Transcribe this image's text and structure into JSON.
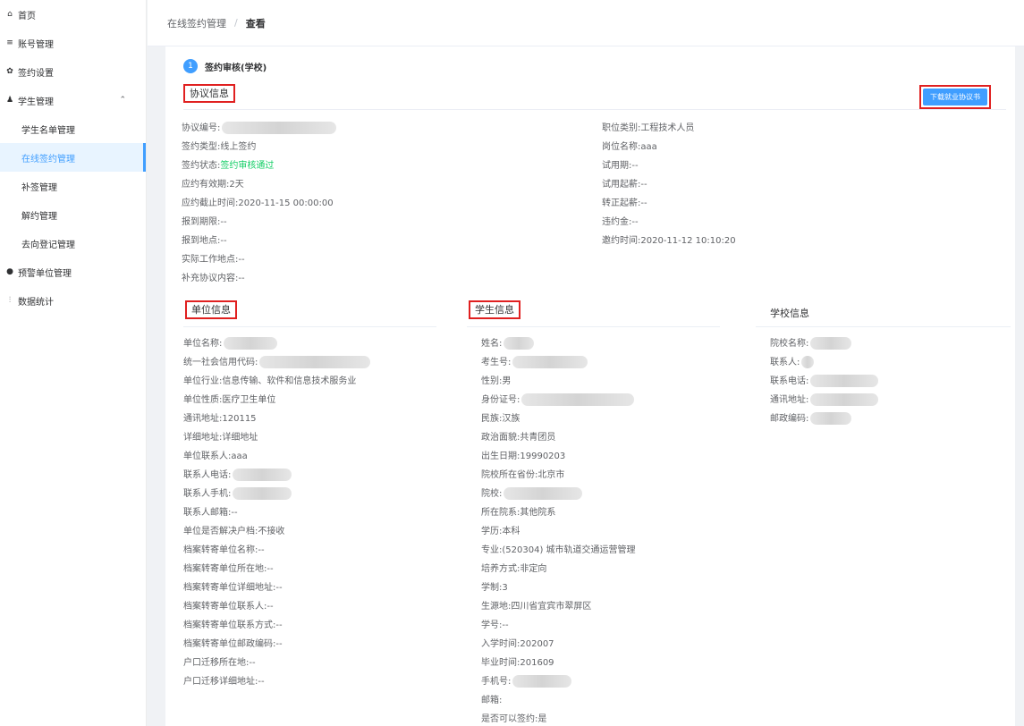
{
  "sidebar": {
    "items": [
      {
        "label": "首页",
        "icon": "home-icon"
      },
      {
        "label": "账号管理",
        "icon": "list-icon"
      },
      {
        "label": "签约设置",
        "icon": "gear-icon"
      },
      {
        "label": "学生管理",
        "icon": "students-icon"
      },
      {
        "label": "学生名单管理"
      },
      {
        "label": "在线签约管理"
      },
      {
        "label": "补签管理"
      },
      {
        "label": "解约管理"
      },
      {
        "label": "去向登记管理"
      },
      {
        "label": "预警单位管理",
        "icon": "alert-icon"
      },
      {
        "label": "数据统计",
        "icon": "chart-icon"
      }
    ]
  },
  "breadcrumb": {
    "parent": "在线签约管理",
    "separator": "/",
    "current": "查看"
  },
  "step": {
    "number": "1",
    "label": "签约审核(学校)"
  },
  "download_button": "下载就业协议书",
  "sections": {
    "agreement": "协议信息",
    "unit": "单位信息",
    "student": "学生信息",
    "school": "学校信息"
  },
  "agreement_left": [
    {
      "k": "协议编号:",
      "v": ""
    },
    {
      "k": "签约类型:",
      "v": "线上签约"
    },
    {
      "k": "签约状态:",
      "v": "签约审核通过"
    },
    {
      "k": "应约有效期:",
      "v": "2天"
    },
    {
      "k": "应约截止时间:",
      "v": "2020-11-15 00:00:00"
    },
    {
      "k": "报到期限:",
      "v": "--"
    },
    {
      "k": "报到地点:",
      "v": "--"
    },
    {
      "k": "实际工作地点:",
      "v": "--"
    },
    {
      "k": "补充协议内容:",
      "v": "--"
    }
  ],
  "agreement_right": [
    {
      "k": "职位类别:",
      "v": "工程技术人员"
    },
    {
      "k": "岗位名称:",
      "v": "aaa"
    },
    {
      "k": "试用期:",
      "v": "--"
    },
    {
      "k": "试用起薪:",
      "v": "--"
    },
    {
      "k": "转正起薪:",
      "v": "--"
    },
    {
      "k": "违约金:",
      "v": "--"
    },
    {
      "k": "邀约时间:",
      "v": "2020-11-12 10:10:20"
    }
  ],
  "unit_fields": [
    {
      "k": "单位名称:",
      "v": ""
    },
    {
      "k": "统一社会信用代码:",
      "v": ""
    },
    {
      "k": "单位行业:",
      "v": "信息传输、软件和信息技术服务业"
    },
    {
      "k": "单位性质:",
      "v": "医疗卫生单位"
    },
    {
      "k": "通讯地址:",
      "v": "120115"
    },
    {
      "k": "详细地址:",
      "v": "详细地址"
    },
    {
      "k": "单位联系人:",
      "v": "aaa"
    },
    {
      "k": "联系人电话:",
      "v": ""
    },
    {
      "k": "联系人手机:",
      "v": ""
    },
    {
      "k": "联系人邮箱:",
      "v": "--"
    },
    {
      "k": "单位是否解决户档:",
      "v": "不接收"
    },
    {
      "k": "档案转寄单位名称:",
      "v": "--"
    },
    {
      "k": "档案转寄单位所在地:",
      "v": "--"
    },
    {
      "k": "档案转寄单位详细地址:",
      "v": "--"
    },
    {
      "k": "档案转寄单位联系人:",
      "v": "--"
    },
    {
      "k": "档案转寄单位联系方式:",
      "v": "--"
    },
    {
      "k": "档案转寄单位邮政编码:",
      "v": "--"
    },
    {
      "k": "户口迁移所在地:",
      "v": "--"
    },
    {
      "k": "户口迁移详细地址:",
      "v": "--"
    }
  ],
  "student_fields": [
    {
      "k": "姓名:",
      "v": ""
    },
    {
      "k": "考生号:",
      "v": ""
    },
    {
      "k": "性别:",
      "v": "男"
    },
    {
      "k": "身份证号:",
      "v": ""
    },
    {
      "k": "民族:",
      "v": "汉族"
    },
    {
      "k": "政治面貌:",
      "v": "共青团员"
    },
    {
      "k": "出生日期:",
      "v": "19990203"
    },
    {
      "k": "院校所在省份:",
      "v": "北京市"
    },
    {
      "k": "院校:",
      "v": ""
    },
    {
      "k": "所在院系:",
      "v": "其他院系"
    },
    {
      "k": "学历:",
      "v": "本科"
    },
    {
      "k": "专业:",
      "v": "(520304) 城市轨道交通运营管理"
    },
    {
      "k": "培养方式:",
      "v": "非定向"
    },
    {
      "k": "学制:",
      "v": "3"
    },
    {
      "k": "生源地:",
      "v": "四川省宜宾市翠屏区"
    },
    {
      "k": "学号:",
      "v": "--"
    },
    {
      "k": "入学时间:",
      "v": "202007"
    },
    {
      "k": "毕业时间:",
      "v": "201609"
    },
    {
      "k": "手机号:",
      "v": ""
    },
    {
      "k": "邮箱:",
      "v": ""
    },
    {
      "k": "是否可以签约:",
      "v": "是"
    }
  ],
  "school_fields": [
    {
      "k": "院校名称:",
      "v": ""
    },
    {
      "k": "联系人:",
      "v": ""
    },
    {
      "k": "联系电话:",
      "v": ""
    },
    {
      "k": "通讯地址:",
      "v": ""
    },
    {
      "k": "邮政编码:",
      "v": ""
    }
  ],
  "colors": {
    "primary": "#409eff",
    "success": "#13ce66",
    "highlight_border": "#e02020"
  }
}
